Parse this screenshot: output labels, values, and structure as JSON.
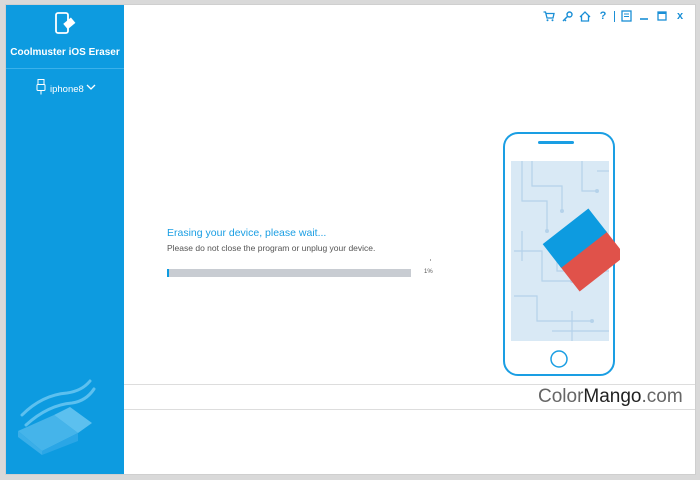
{
  "app": {
    "title": "Coolmuster iOS Eraser"
  },
  "device": {
    "name": "iphone8"
  },
  "status": {
    "title": "Erasing your device, please wait...",
    "subtitle": "Please do not close the program or unplug your device.",
    "progress_percent": 1,
    "progress_label": "1%"
  },
  "titlebar": {
    "icons": [
      "cart-icon",
      "key-icon",
      "home-icon",
      "help-icon",
      "feedback-icon",
      "minimize-icon",
      "maximize-icon",
      "close-icon"
    ],
    "help_label": "?",
    "close_label": "x"
  },
  "watermark": {
    "part1": "Color",
    "part2": "Mango",
    "part3": ".com"
  },
  "colors": {
    "accent": "#0d9be0",
    "eraser_blue": "#0d9be0",
    "eraser_red": "#e0524a"
  }
}
